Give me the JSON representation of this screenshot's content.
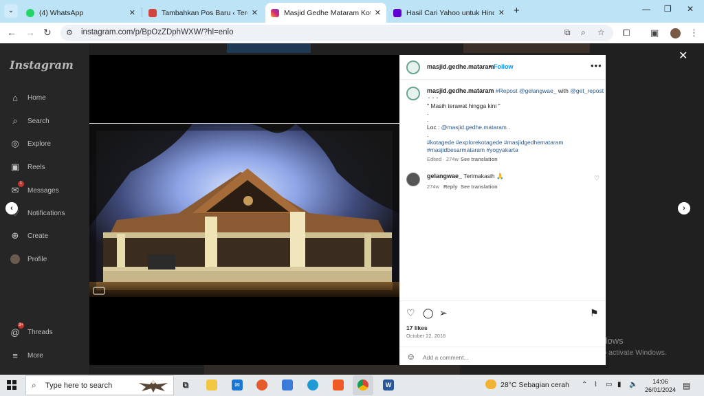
{
  "browser": {
    "tabs": [
      {
        "title": "(4) WhatsApp",
        "favicon": "whatsapp-icon",
        "color": "#25d366",
        "active": false
      },
      {
        "title": "Tambahkan Pos Baru ‹ Teropong",
        "favicon": "gift-icon",
        "color": "#d0443b",
        "active": false
      },
      {
        "title": "Masjid Gedhe Mataram Kotagede",
        "favicon": "instagram-icon",
        "color": "#d62976",
        "active": true
      },
      {
        "title": "Hasil Cari Yahoo untuk Hindu di",
        "favicon": "yahoo-icon",
        "color": "#6001d2",
        "active": false
      }
    ],
    "url": "instagram.com/p/BpOzZDphWXW/?hl=enlo"
  },
  "sidebar": {
    "logo": "Instagram",
    "items": [
      {
        "label": "Home",
        "icon": "home-icon"
      },
      {
        "label": "Search",
        "icon": "search-icon"
      },
      {
        "label": "Explore",
        "icon": "compass-icon"
      },
      {
        "label": "Reels",
        "icon": "reels-icon"
      },
      {
        "label": "Messages",
        "icon": "messenger-icon",
        "badge": "1"
      },
      {
        "label": "Notifications",
        "icon": "heart-icon"
      },
      {
        "label": "Create",
        "icon": "plus-icon"
      },
      {
        "label": "Profile",
        "icon": "profile-avatar"
      },
      {
        "label": "Threads",
        "icon": "threads-icon",
        "badge": "9+"
      },
      {
        "label": "More",
        "icon": "menu-icon"
      }
    ]
  },
  "post": {
    "username": "masjid.gedhe.mataram",
    "follow_label": "Follow",
    "caption": {
      "mention_repost": "#Repost @gelangwae_",
      "with_text": " with ",
      "mention_getrepost": "@get_repost",
      "dots": "・・・",
      "quote": "\" Masih terawat hingga kini \"",
      "dot": ".",
      "loc_label": "Loc : ",
      "loc_value": "@masjid.gedhe.mataram",
      "loc_dot": " .",
      "hashtags_line1": "#kotagede #explorekotagede #masjidgedhemataram",
      "hashtags_line2": "#masjidbesarmataram #yogyakarta",
      "meta": "Edited · 274w",
      "see_translation": "See translation"
    },
    "comment": {
      "username": "gelangwae_",
      "text": "Terimakasih 🙏",
      "age": "274w",
      "reply": "Reply",
      "see_translation": "See translation"
    },
    "likes": "17 likes",
    "date": "October 22, 2018",
    "add_comment_placeholder": "Add a comment..."
  },
  "watermark": {
    "title": "Activate Windows",
    "subtitle": "Go to Settings to activate Windows."
  },
  "taskbar": {
    "search_placeholder": "Type here to search",
    "weather": "28°C  Sebagian cerah",
    "time": "14:06",
    "date": "26/01/2024"
  }
}
